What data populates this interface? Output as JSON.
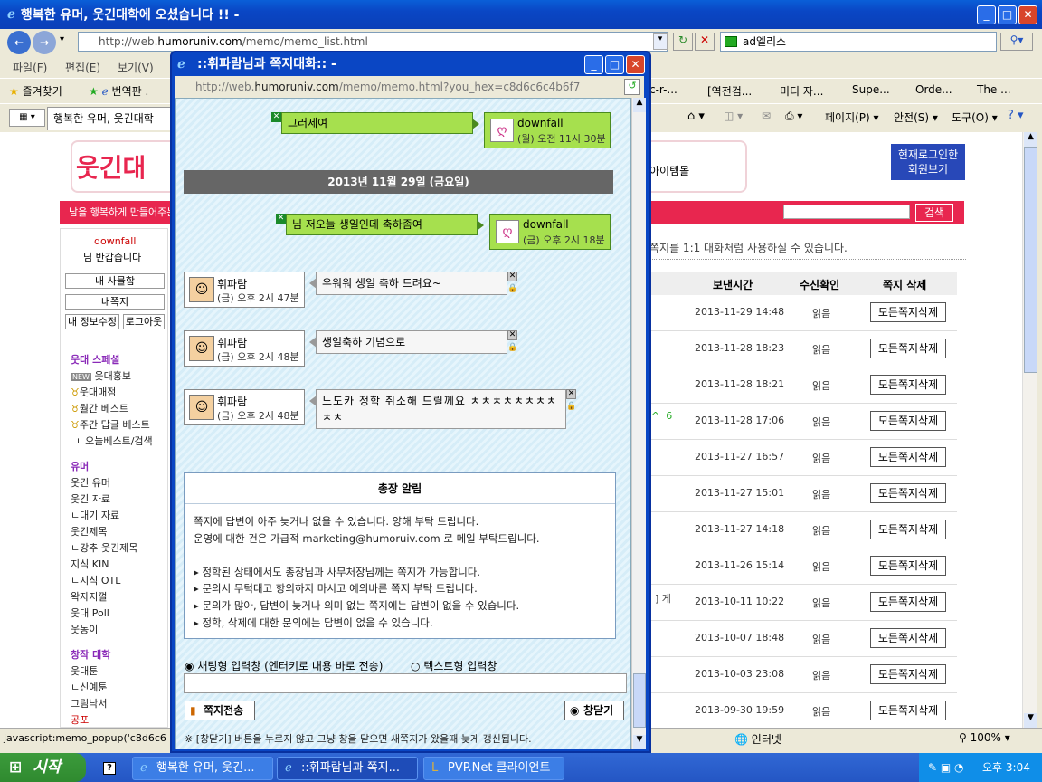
{
  "main_window": {
    "title": "행복한 유머, 웃긴대학에 오셨습니다 !! -",
    "url_prefix": "http://web.",
    "url_domain": "humoruniv.com",
    "url_path": "/memo/memo_list.html",
    "search_text": "ad엘리스",
    "menu": [
      "파일(F)",
      "편집(E)",
      "보기(V)"
    ],
    "favorites_label": "즐겨찾기",
    "fav_translate": "번역판 .",
    "fav_links": [
      "c-r-...",
      "[역전검...",
      "미디 자...",
      "Supe...",
      "Orde...",
      "The ..."
    ],
    "tab_title": "행복한 유머, 웃긴대학",
    "tools": [
      "페이지(P)",
      "안전(S)",
      "도구(O)"
    ],
    "status_text": "javascript:memo_popup('c8d6c6",
    "status_zone": "인터넷",
    "zoom": "100%"
  },
  "background_page": {
    "logo_text": "웃긴대",
    "item_shop": "아이템몰",
    "pink_bar_text": "남을 행복하게 만들어주는",
    "search_btn": "검색",
    "login_box": [
      "현재로그인한",
      "회원보기"
    ],
    "user_name": "downfall",
    "greeting": "님 반갑습니다",
    "user_buttons": [
      "내 사물함",
      "내쪽지",
      "내 정보수정",
      "로그아웃"
    ],
    "section_special": "웃대 스페셜",
    "special_items": [
      "웃대홍보",
      "웃대매점",
      "월간 베스트",
      "주간 답글 베스트",
      "오늘베스트/검색"
    ],
    "section_humor": "유머",
    "humor_items": [
      "웃긴 유머",
      "웃긴 자료",
      "대기 자료",
      "웃긴제목",
      "강추 웃긴제목",
      "지식 KIN",
      "지식 OTL",
      "왁자지껄",
      "웃대 Poll",
      "웃동이"
    ],
    "section_creative": "창작 대학",
    "creative_items": [
      "웃대툰",
      "신예툰",
      "그림낙서",
      "공포"
    ],
    "info_text": "쪽지를 1:1 대화처럼 사용하실 수 있습니다.",
    "table_headers": [
      "보낸시간",
      "수신확인",
      "쪽지 삭제"
    ],
    "snippet1": "^  6",
    "snippet2": "] 게",
    "rows": [
      {
        "date": "2013-11-29 14:48",
        "read": "읽음",
        "del": "모든쪽지삭제"
      },
      {
        "date": "2013-11-28 18:23",
        "read": "읽음",
        "del": "모든쪽지삭제"
      },
      {
        "date": "2013-11-28 18:21",
        "read": "읽음",
        "del": "모든쪽지삭제"
      },
      {
        "date": "2013-11-28 17:06",
        "read": "읽음",
        "del": "모든쪽지삭제"
      },
      {
        "date": "2013-11-27 16:57",
        "read": "읽음",
        "del": "모든쪽지삭제"
      },
      {
        "date": "2013-11-27 15:01",
        "read": "읽음",
        "del": "모든쪽지삭제"
      },
      {
        "date": "2013-11-27 14:18",
        "read": "읽음",
        "del": "모든쪽지삭제"
      },
      {
        "date": "2013-11-26 15:14",
        "read": "읽음",
        "del": "모든쪽지삭제"
      },
      {
        "date": "2013-10-11 10:22",
        "read": "읽음",
        "del": "모든쪽지삭제"
      },
      {
        "date": "2013-10-07 18:48",
        "read": "읽음",
        "del": "모든쪽지삭제"
      },
      {
        "date": "2013-10-03 23:08",
        "read": "읽음",
        "del": "모든쪽지삭제"
      },
      {
        "date": "2013-09-30 19:59",
        "read": "읽음",
        "del": "모든쪽지삭제"
      }
    ]
  },
  "popup": {
    "title": "::휘파람님과 쪽지대화:: -",
    "url_prefix": "http://web.",
    "url_domain": "humoruniv.com",
    "url_path": "/memo/memo.html?you_hex=c8d6c6c4b6f7",
    "msg1": {
      "text": "그러세여",
      "sender": "downfall",
      "time": "(월) 오전 11시 30분"
    },
    "date_banner": "2013년 11월 29일 (금요일)",
    "msg2": {
      "text": "님 저오늘 생일인데 축하좀여",
      "sender": "downfall",
      "time": "(금) 오후 2시 18분"
    },
    "replies": [
      {
        "sender": "휘파람",
        "time": "(금) 오후 2시 47분",
        "text": "우워워 생일 축하 드려요~"
      },
      {
        "sender": "휘파람",
        "time": "(금) 오후 2시 48분",
        "text": "생일축하 기념으로"
      },
      {
        "sender": "휘파람",
        "time": "(금) 오후 2시 48분",
        "text": "노도카 정학 취소해 드릴께요 ㅊㅊㅊㅊㅊㅊㅊㅊㅊㅊ"
      }
    ],
    "notice_title": "총장 알림",
    "notice_lines": [
      "쪽지에 답변이 아주 늦거나 없을 수 있습니다. 양해 부탁 드립니다.",
      "운영에 대한 건은 가급적 marketing@humoruiv.com 로 메일 부탁드립니다."
    ],
    "notice_bullets": [
      "정학된 상태에서도 총장님과 사무처장님께는 쪽지가 가능합니다.",
      "문의시 무턱대고 항의하지 마시고 예의바른 쪽지 부탁 드립니다.",
      "문의가 많아, 답변이 늦거나 의미 없는 쪽지에는 답변이 없을 수 있습니다.",
      "정학, 삭제에 대한 문의에는 답변이 없을 수 있습니다."
    ],
    "radio_chat": "채팅형 입력창 (엔터키로 내용 바로 전송)",
    "radio_text": "텍스트형 입력창",
    "send_btn": "쪽지전송",
    "close_btn": "창닫기",
    "footer_note": "※ [창닫기] 버튼을 누르지 않고 그냥 창을 닫으면 새쪽지가 왔을때 늦게 갱신됩니다."
  },
  "taskbar": {
    "start": "시작",
    "tasks": [
      "행복한 유머, 웃긴...",
      "::휘파람님과 쪽지...",
      "PVP.Net 클라이언트"
    ],
    "clock": "오후 3:04"
  }
}
